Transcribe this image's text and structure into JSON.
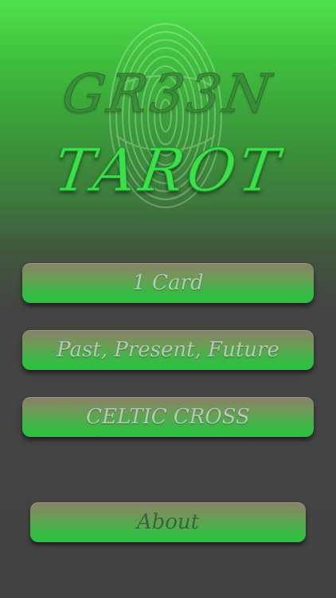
{
  "app": {
    "title_line1": "GR33N",
    "title_line2": "TAROT"
  },
  "menu": {
    "one_card": "1 Card",
    "past_present_future": "Past, Present, Future",
    "celtic_cross": "CELTIC CROSS",
    "about": "About"
  },
  "icons": {
    "background_art": "fingerprint-icon"
  },
  "colors": {
    "accent_green": "#3be04a",
    "background_dark": "#434343",
    "button_text": "#b7c8b7"
  }
}
